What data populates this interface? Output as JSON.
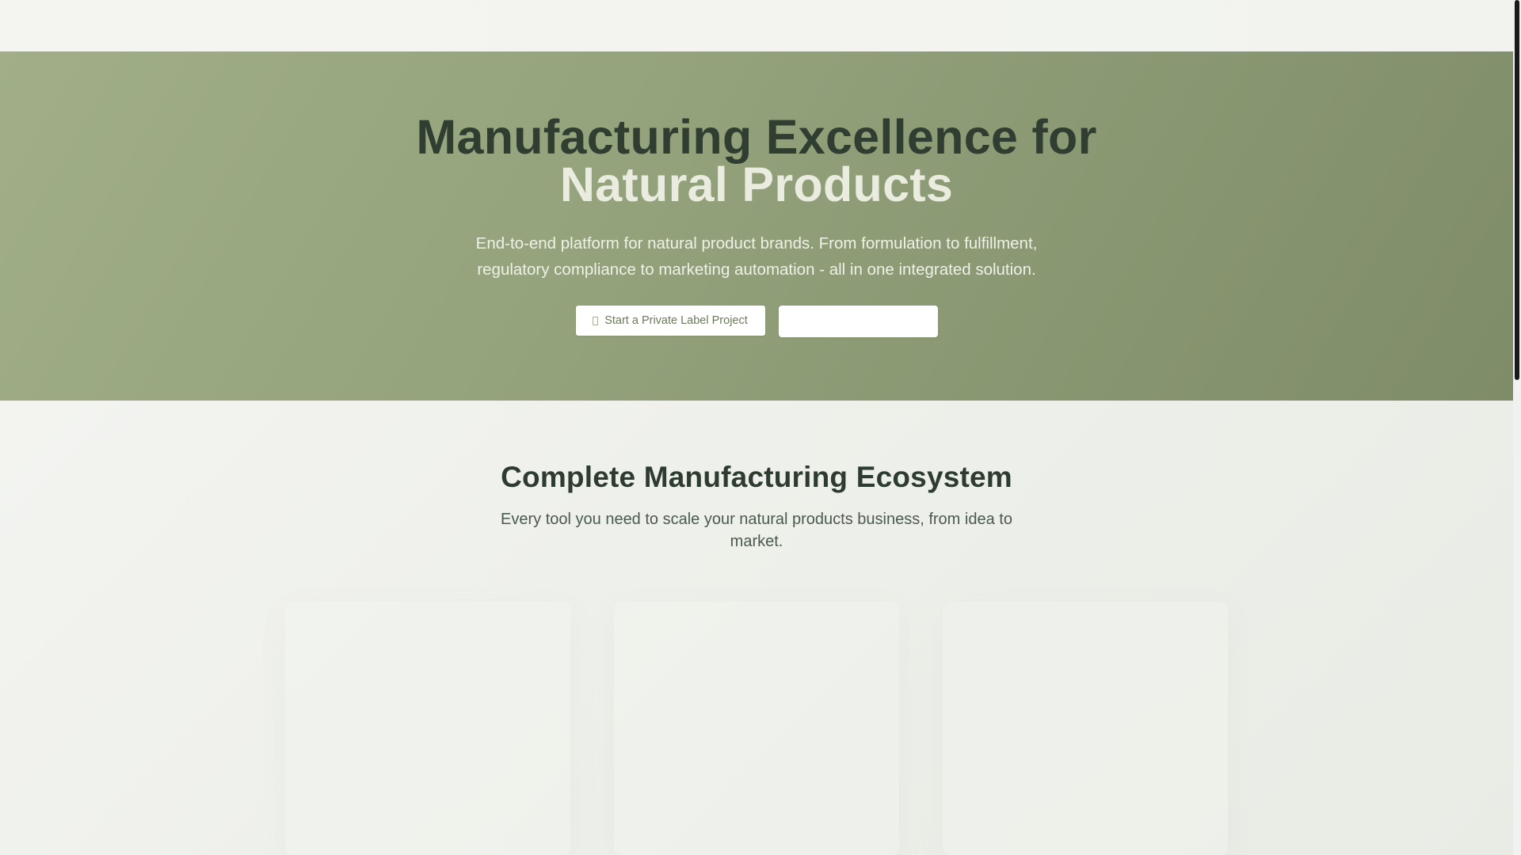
{
  "hero": {
    "title_line1": "Manufacturing Excellence for",
    "title_line2": "Natural Products",
    "subtitle_line1": "End-to-end platform for natural product brands. From formulation to fulfillment,",
    "subtitle_line2": "regulatory compliance to marketing automation - all in one integrated solution.",
    "primary_button_label": "Start a Private Label Project",
    "primary_button_icon": "leaf-icon",
    "secondary_button_label": ""
  },
  "ecosystem": {
    "title": "Complete Manufacturing Ecosystem",
    "subtitle": "Every tool you need to scale your natural products business, from idea to market."
  },
  "colors": {
    "hero_start": "#a1ae88",
    "hero_end": "#7f8c68",
    "title_dark": "#2f3e30",
    "title_light": "#e9ecdf",
    "button_text": "#6a7a5a"
  }
}
